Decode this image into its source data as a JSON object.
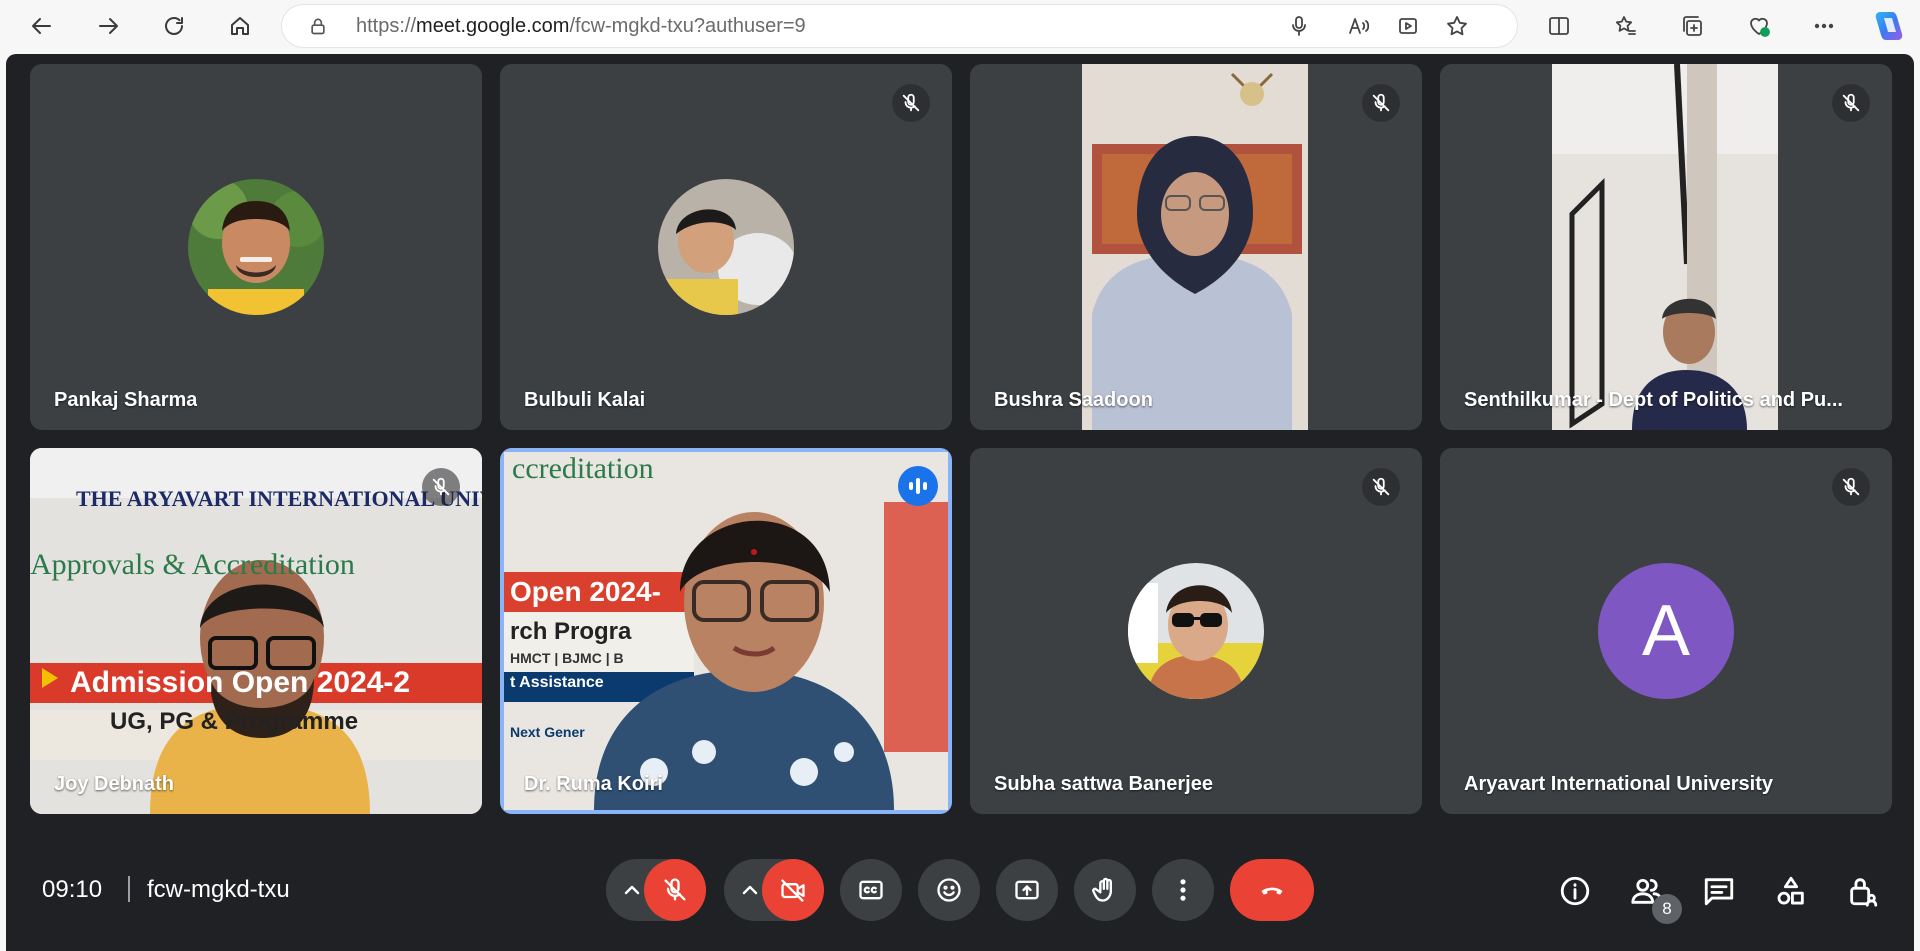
{
  "browser": {
    "url_prefix": "https://",
    "url_host": "meet.google.com",
    "url_path": "/fcw-mgkd-txu?authuser=9"
  },
  "meeting": {
    "time": "09:10",
    "code": "fcw-mgkd-txu",
    "participant_count": "8"
  },
  "participants": [
    {
      "name": "Pankaj Sharma",
      "muted": false,
      "view": "avatar-photo"
    },
    {
      "name": "Bulbuli Kalai",
      "muted": true,
      "view": "avatar-photo"
    },
    {
      "name": "Bushra Saadoon",
      "muted": true,
      "view": "video"
    },
    {
      "name": "Senthilkumar - Dept of Politics and Pu...",
      "muted": true,
      "view": "video"
    },
    {
      "name": "Joy Debnath",
      "muted": true,
      "view": "video"
    },
    {
      "name": "Dr. Ruma Koiri",
      "muted": false,
      "speaking": true,
      "view": "video"
    },
    {
      "name": "Subha sattwa Banerjee",
      "muted": true,
      "view": "avatar-photo"
    },
    {
      "name": "Aryavart International University",
      "muted": true,
      "view": "avatar-letter",
      "letter": "A"
    }
  ],
  "video_text": {
    "joy_banner_title": "THE ARYAVART INTERNATIONAL UNIVE",
    "joy_banner_line1": "Approvals & Accreditation",
    "joy_banner_line2": "Admission Open 2024-2",
    "joy_banner_line3": "UG, PG & Programme",
    "ruma_banner_line1": "ccreditation",
    "ruma_banner_line2": "Open 2024-",
    "ruma_banner_line3": "rch Progra",
    "ruma_banner_line4": "HMCT | BJMC | B",
    "ruma_banner_line5": "t Assistance",
    "ruma_banner_line6": "Next Gener"
  },
  "colors": {
    "meet_bg": "#202124",
    "tile_bg": "#3c4043",
    "danger": "#ea4335",
    "speaking_border": "#8ab4f8",
    "avatar_letter_bg": "#7e57c2"
  }
}
